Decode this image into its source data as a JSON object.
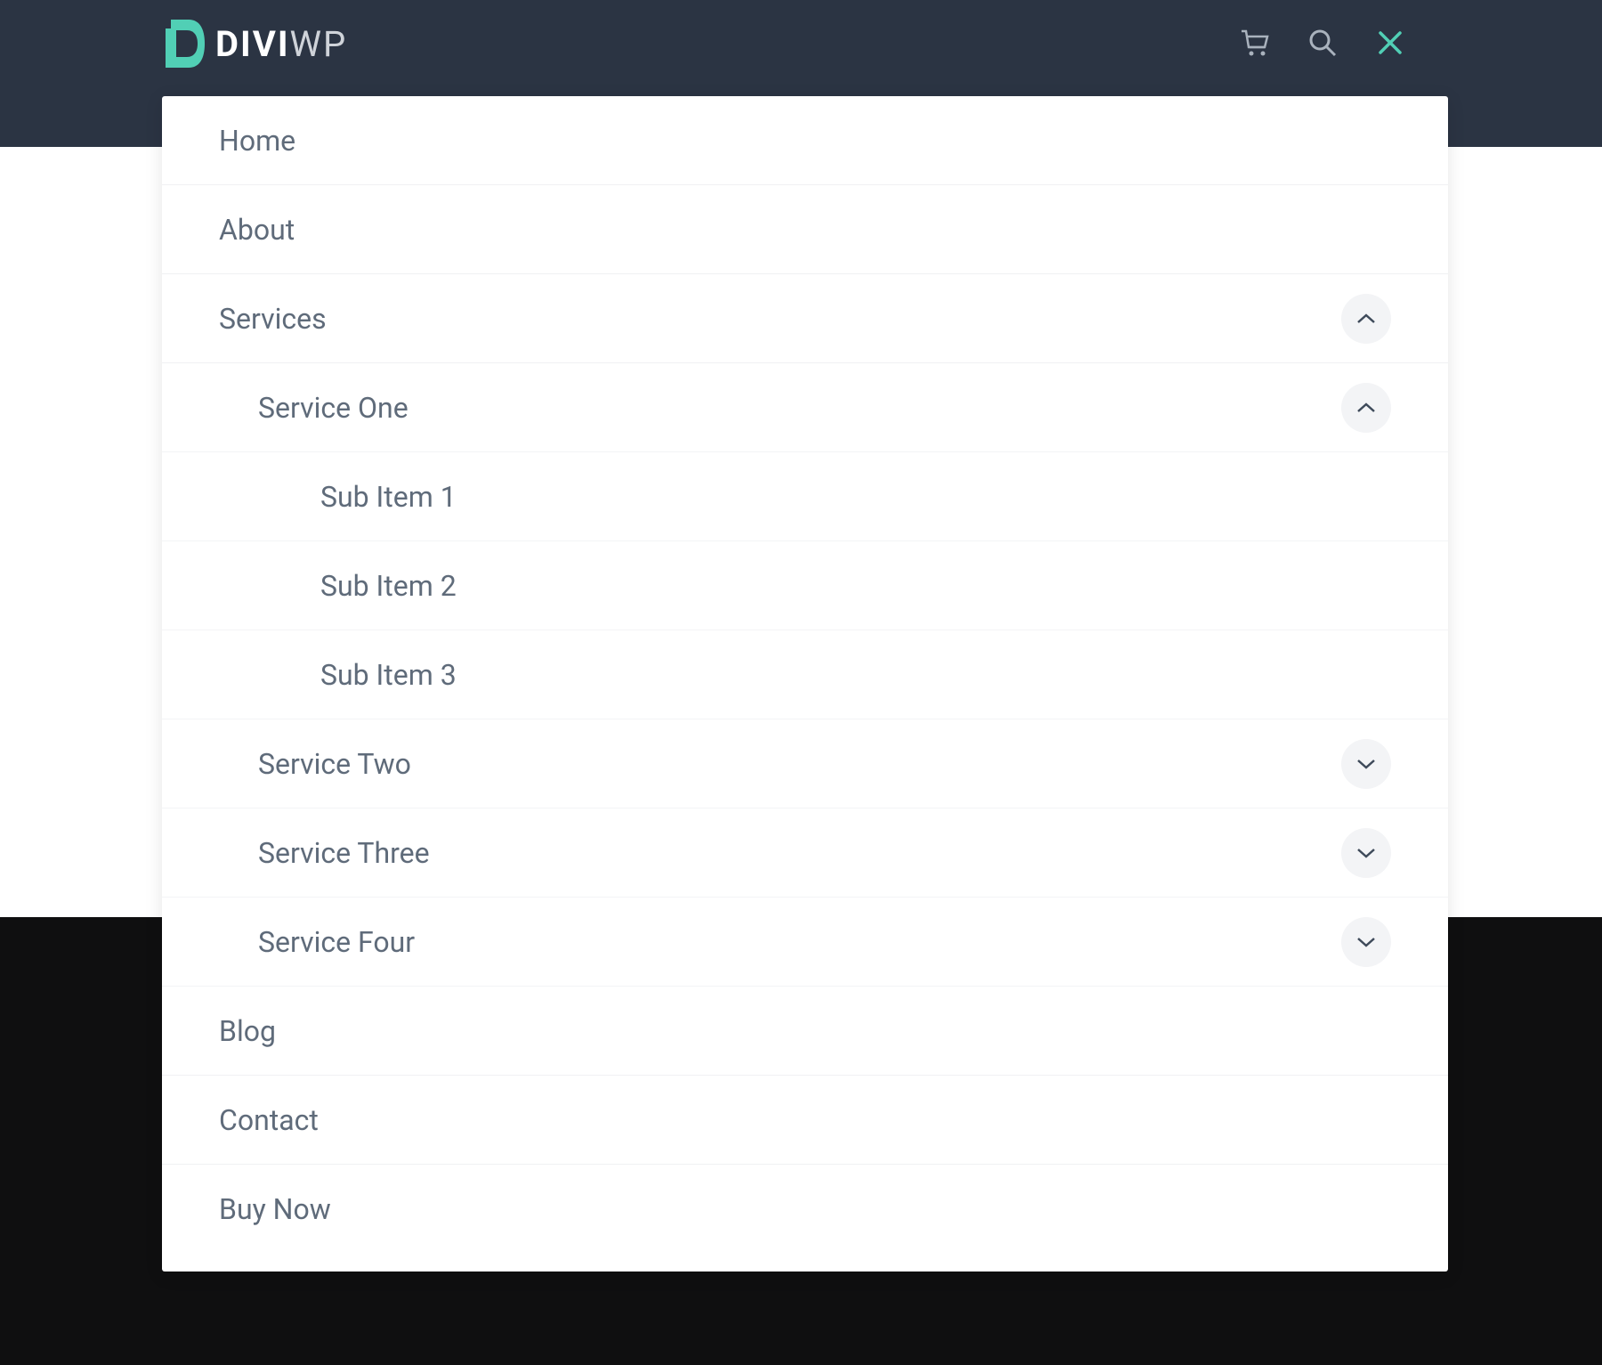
{
  "brand": {
    "text_a": "DIVI",
    "text_b": "WP"
  },
  "colors": {
    "accent": "#51cfb5",
    "header_bg": "#2b3443",
    "text": "#5f6b7a",
    "toggle_bg": "#f3f4f6",
    "chevron": "#3e4a5a"
  },
  "menu": {
    "home": "Home",
    "about": "About",
    "services": {
      "label": "Services",
      "service_one": {
        "label": "Service One",
        "sub1": "Sub Item 1",
        "sub2": "Sub Item 2",
        "sub3": "Sub Item 3"
      },
      "service_two": {
        "label": "Service Two"
      },
      "service_three": {
        "label": "Service Three"
      },
      "service_four": {
        "label": "Service Four"
      }
    },
    "blog": "Blog",
    "contact": "Contact",
    "buy_now": "Buy Now"
  }
}
